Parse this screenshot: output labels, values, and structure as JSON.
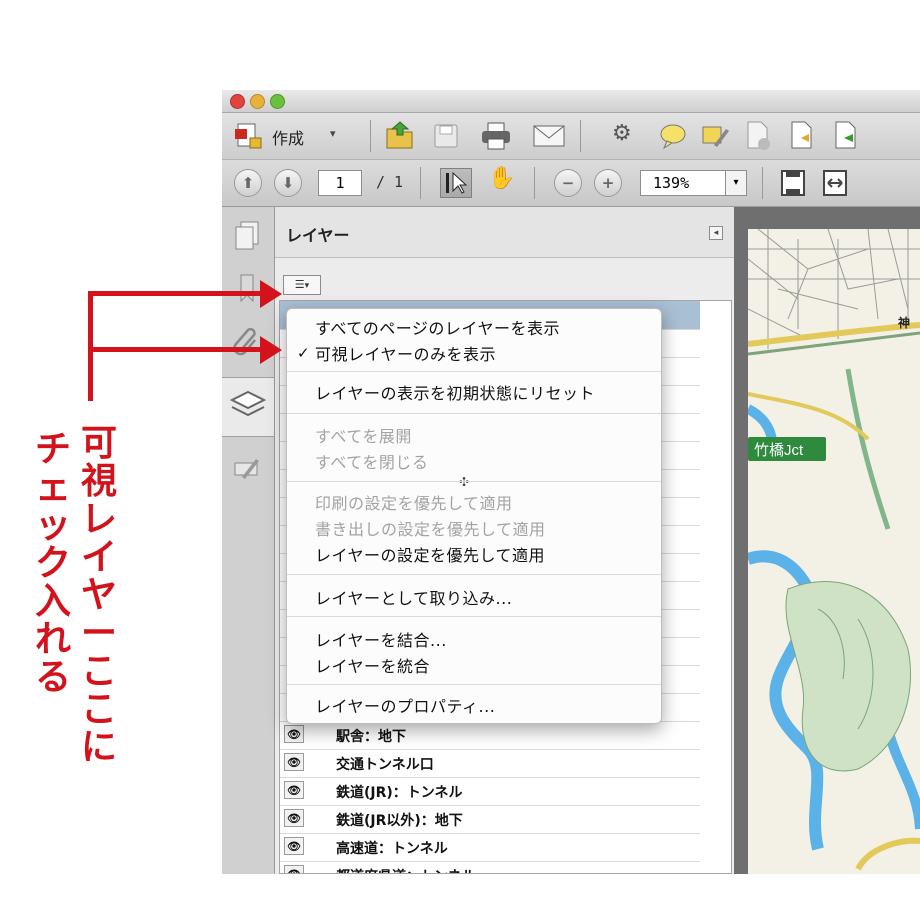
{
  "toolbar": {
    "create_label": "作成",
    "page_current": "1",
    "page_total": "/ 1",
    "zoom_value": "139%"
  },
  "panel": {
    "title": "レイヤー"
  },
  "menu": {
    "items": [
      {
        "label": "すべてのページのレイヤーを表示",
        "enabled": true
      },
      {
        "label": "可視レイヤーのみを表示",
        "enabled": true,
        "checked": true
      },
      {
        "label": "レイヤーの表示を初期状態にリセット",
        "enabled": true
      },
      {
        "label": "すべてを展開",
        "enabled": false
      },
      {
        "label": "すべてを閉じる",
        "enabled": false
      },
      {
        "label": "印刷の設定を優先して適用",
        "enabled": false
      },
      {
        "label": "書き出しの設定を優先して適用",
        "enabled": false
      },
      {
        "label": "レイヤーの設定を優先して適用",
        "enabled": true
      },
      {
        "label": "レイヤーとして取り込み...",
        "enabled": true
      },
      {
        "label": "レイヤーを結合...",
        "enabled": true
      },
      {
        "label": "レイヤーを統合",
        "enabled": true
      },
      {
        "label": "レイヤーのプロパティ...",
        "enabled": true
      }
    ]
  },
  "layers": {
    "visible_rows": [
      "駅舎：地下",
      "交通トンネル口",
      "鉄道(JR)：トンネル",
      "鉄道(JR以外)：地下",
      "高速道：トンネル",
      "都道府県道：トンネル"
    ]
  },
  "map": {
    "label_jct": "竹橋Jct",
    "label_partial": "神"
  },
  "annotation": {
    "text": "可視レイヤーここにチェック入れる",
    "col1": "可視レイヤーここに",
    "col2": "チェック入れる",
    "color": "#d4121b"
  }
}
